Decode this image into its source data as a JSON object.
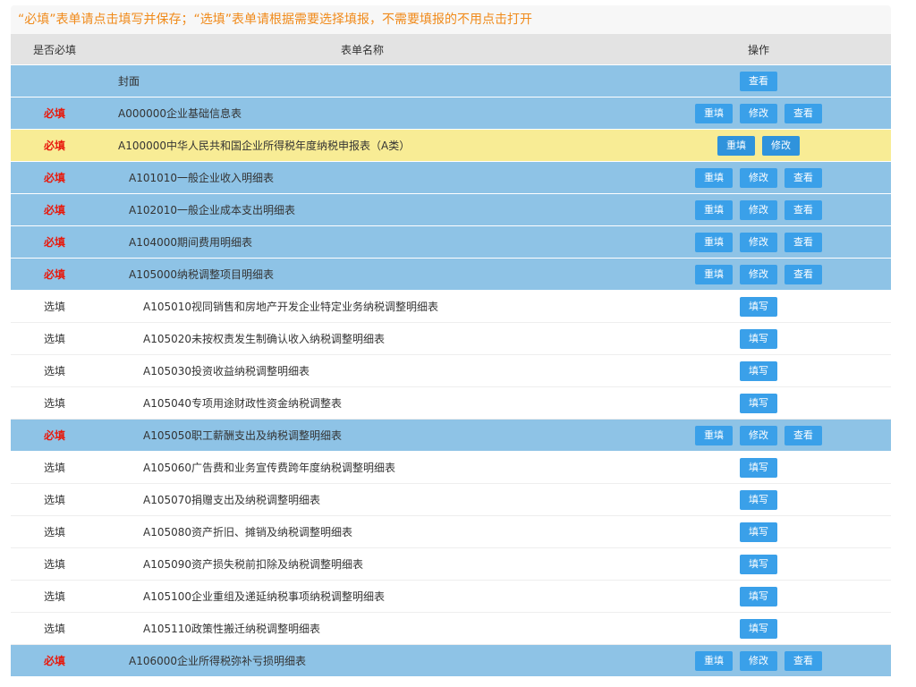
{
  "notice": "“必填”表单请点击填写并保存；“选填”表单请根据需要选择填报，不需要填报的不用点击打开",
  "headers": {
    "required": "是否必填",
    "name": "表单名称",
    "ops": "操作"
  },
  "labels": {
    "must": "必填",
    "optional": "选填",
    "refill": "重填",
    "edit": "修改",
    "view": "查看",
    "fill": "填写"
  },
  "colors": {
    "accent": "#3aa0e9",
    "row_required": "#8ec3e6",
    "row_current": "#f8ec95",
    "must_text": "#e8190c",
    "notice_text": "#f08a1a"
  },
  "rows": [
    {
      "req": "",
      "name": "封面",
      "level": 0,
      "style": "blue",
      "ops": [
        "view"
      ]
    },
    {
      "req": "must",
      "name": "A000000企业基础信息表",
      "level": 0,
      "style": "blue",
      "ops": [
        "refill",
        "edit",
        "view"
      ]
    },
    {
      "req": "must",
      "name": "A100000中华人民共和国企业所得税年度纳税申报表（A类）",
      "level": 0,
      "style": "yellow",
      "ops": [
        "refill",
        "edit"
      ]
    },
    {
      "req": "must",
      "name": "A101010一般企业收入明细表",
      "level": 1,
      "style": "blue",
      "ops": [
        "refill",
        "edit",
        "view"
      ]
    },
    {
      "req": "must",
      "name": "A102010一般企业成本支出明细表",
      "level": 1,
      "style": "blue",
      "ops": [
        "refill",
        "edit",
        "view"
      ]
    },
    {
      "req": "must",
      "name": "A104000期间费用明细表",
      "level": 1,
      "style": "blue",
      "ops": [
        "refill",
        "edit",
        "view"
      ]
    },
    {
      "req": "must",
      "name": "A105000纳税调整项目明细表",
      "level": 1,
      "style": "blue",
      "ops": [
        "refill",
        "edit",
        "view"
      ]
    },
    {
      "req": "optional",
      "name": "A105010视同销售和房地产开发企业特定业务纳税调整明细表",
      "level": 2,
      "style": "white",
      "ops": [
        "fill"
      ]
    },
    {
      "req": "optional",
      "name": "A105020未按权责发生制确认收入纳税调整明细表",
      "level": 2,
      "style": "white",
      "ops": [
        "fill"
      ]
    },
    {
      "req": "optional",
      "name": "A105030投资收益纳税调整明细表",
      "level": 2,
      "style": "white",
      "ops": [
        "fill"
      ]
    },
    {
      "req": "optional",
      "name": "A105040专项用途财政性资金纳税调整表",
      "level": 2,
      "style": "white",
      "ops": [
        "fill"
      ]
    },
    {
      "req": "must",
      "name": "A105050职工薪酬支出及纳税调整明细表",
      "level": 2,
      "style": "blue",
      "ops": [
        "refill",
        "edit",
        "view"
      ]
    },
    {
      "req": "optional",
      "name": "A105060广告费和业务宣传费跨年度纳税调整明细表",
      "level": 2,
      "style": "white",
      "ops": [
        "fill"
      ]
    },
    {
      "req": "optional",
      "name": "A105070捐赠支出及纳税调整明细表",
      "level": 2,
      "style": "white",
      "ops": [
        "fill"
      ]
    },
    {
      "req": "optional",
      "name": "A105080资产折旧、摊销及纳税调整明细表",
      "level": 2,
      "style": "white",
      "ops": [
        "fill"
      ]
    },
    {
      "req": "optional",
      "name": "A105090资产损失税前扣除及纳税调整明细表",
      "level": 2,
      "style": "white",
      "ops": [
        "fill"
      ]
    },
    {
      "req": "optional",
      "name": "A105100企业重组及递延纳税事项纳税调整明细表",
      "level": 2,
      "style": "white",
      "ops": [
        "fill"
      ]
    },
    {
      "req": "optional",
      "name": "A105110政策性搬迁纳税调整明细表",
      "level": 2,
      "style": "white",
      "ops": [
        "fill"
      ]
    },
    {
      "req": "must",
      "name": "A106000企业所得税弥补亏损明细表",
      "level": 1,
      "style": "blue",
      "ops": [
        "refill",
        "edit",
        "view"
      ]
    }
  ]
}
